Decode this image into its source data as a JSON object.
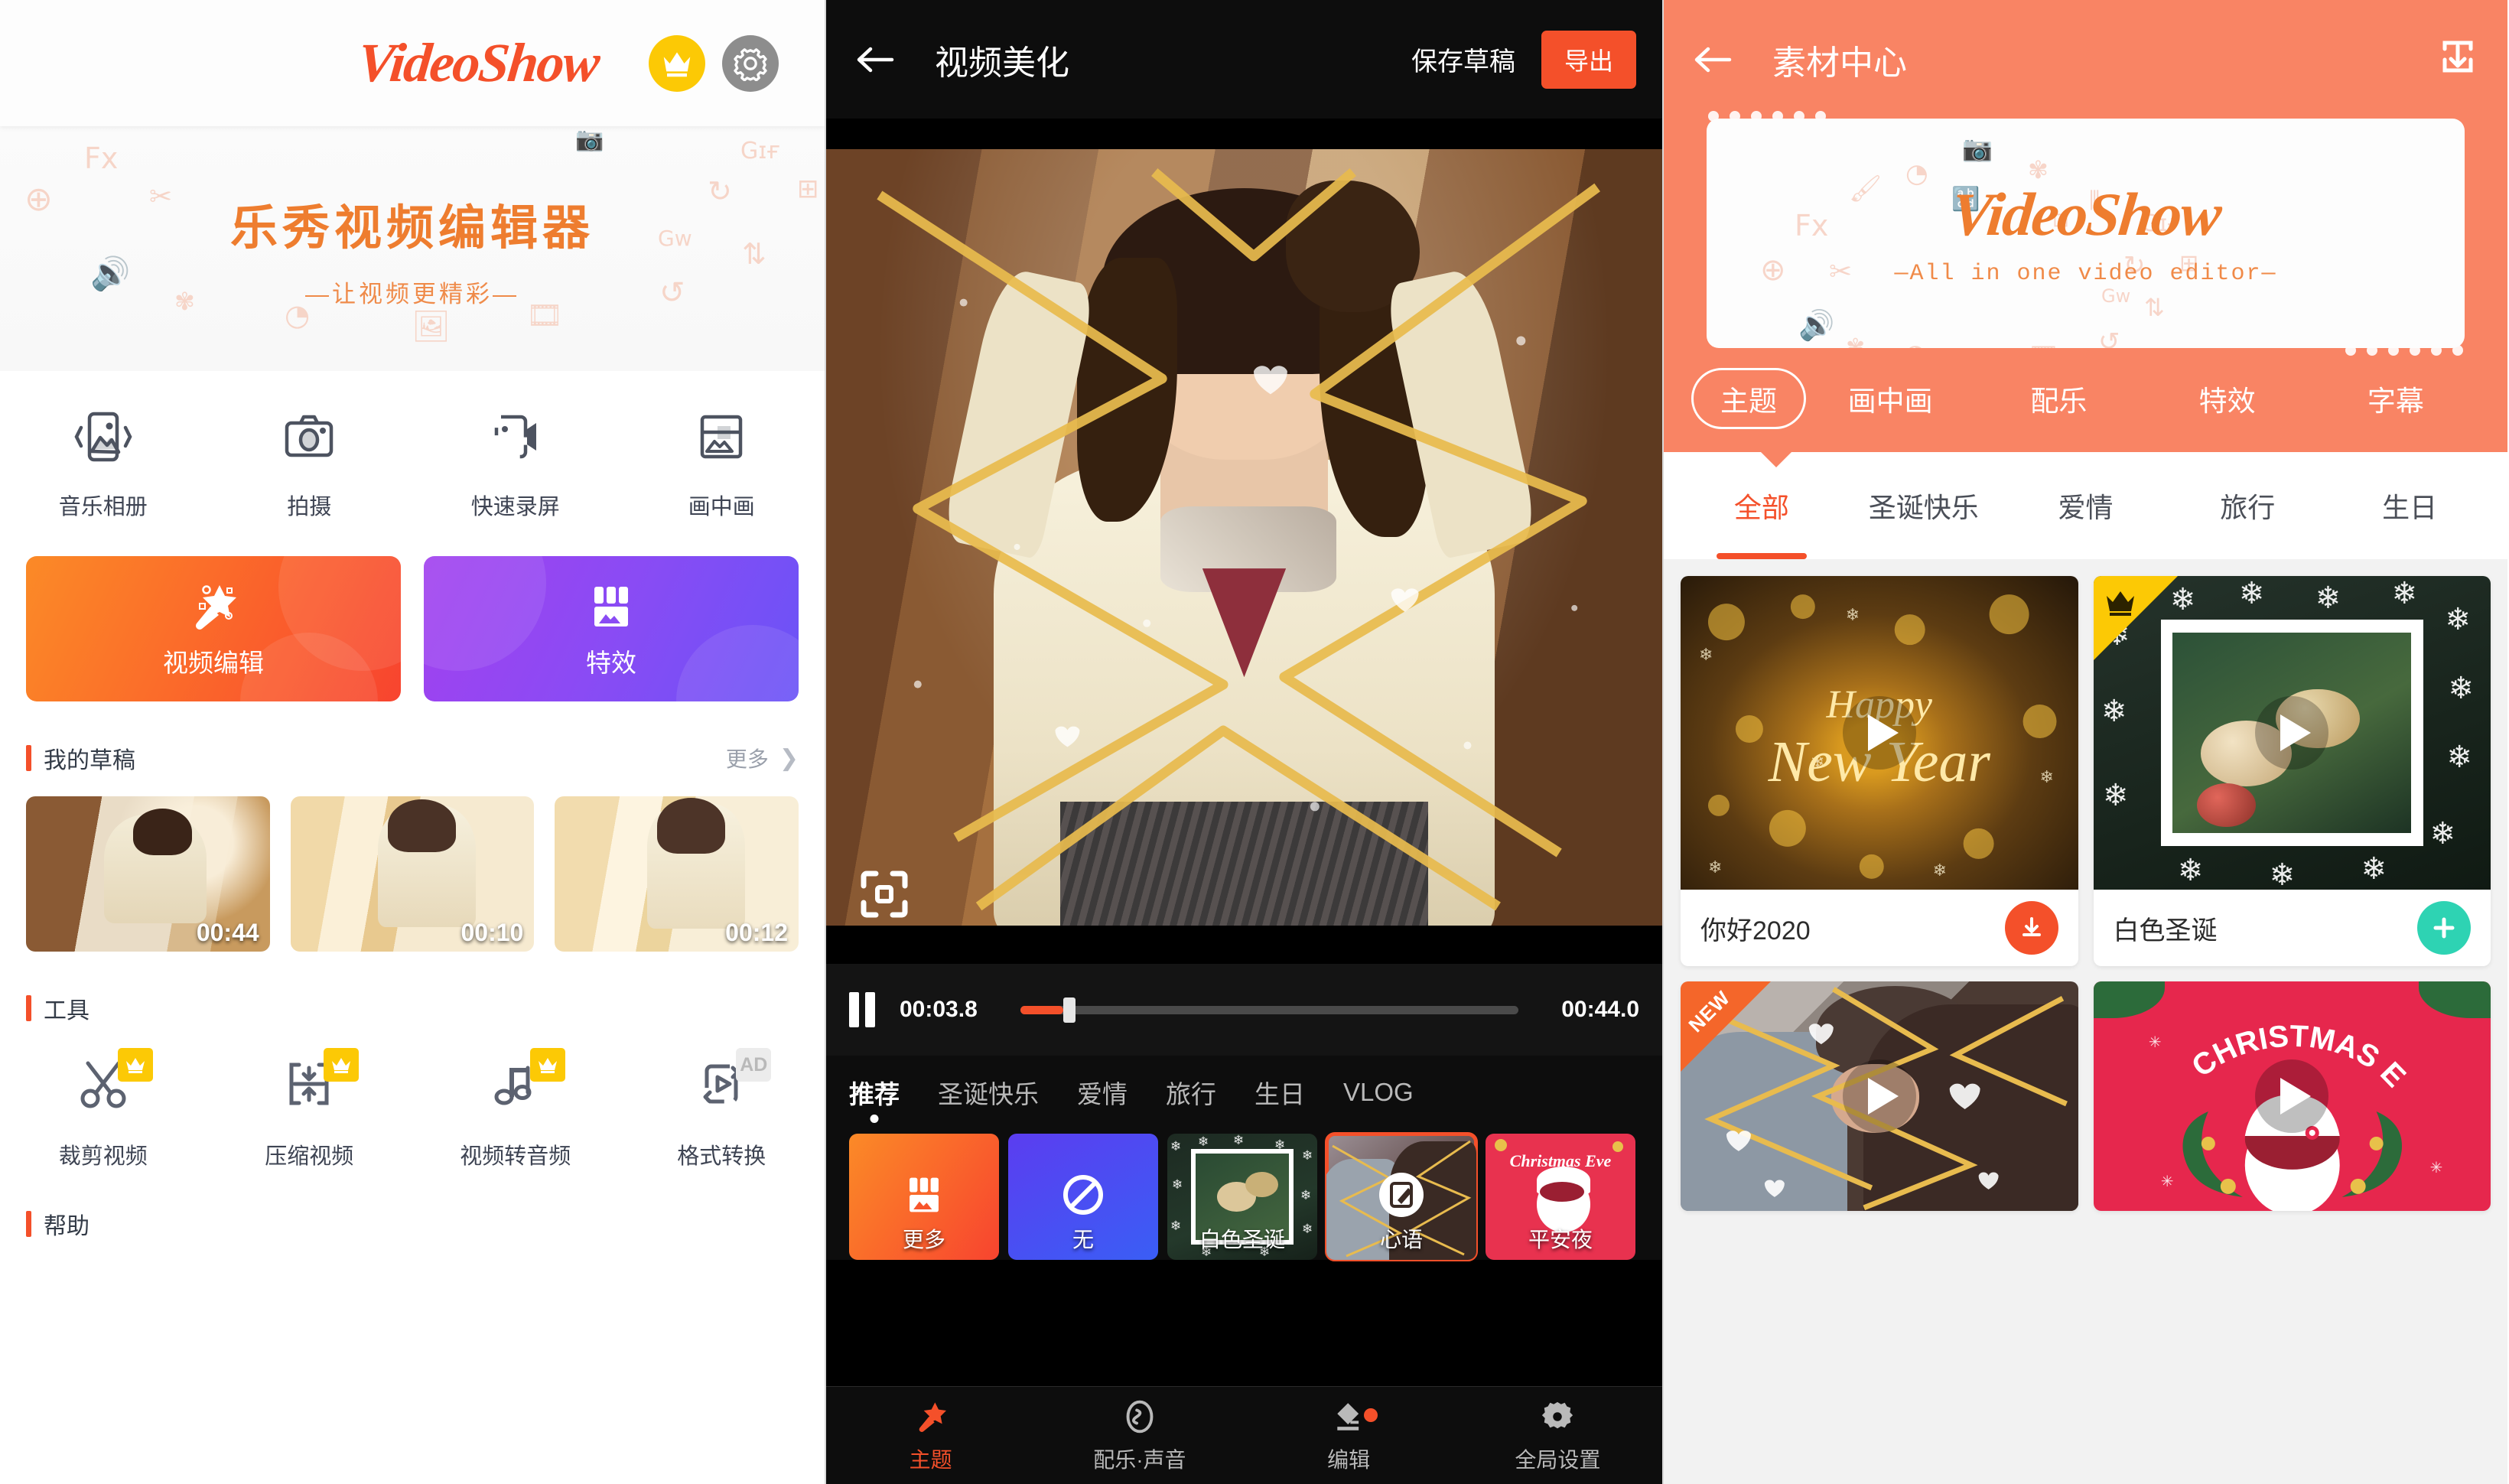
{
  "panel1": {
    "brand": "VideoShow",
    "icons": {
      "crown": "crown-icon",
      "gear": "gear-icon"
    },
    "banner": {
      "title": "乐秀视频编辑器",
      "subtitle": "—让视频更精彩—"
    },
    "shortcuts": [
      {
        "label": "音乐相册",
        "icon": "music-album-icon"
      },
      {
        "label": "拍摄",
        "icon": "camera-icon"
      },
      {
        "label": "快速录屏",
        "icon": "screen-record-icon"
      },
      {
        "label": "画中画",
        "icon": "picture-in-picture-icon"
      }
    ],
    "primary_buttons": [
      {
        "label": "视频编辑",
        "icon": "magic-wand-icon",
        "color": "#f8552c"
      },
      {
        "label": "特效",
        "icon": "effects-store-icon",
        "color": "#8a4bf4"
      }
    ],
    "drafts_section": {
      "title": "我的草稿",
      "more": "更多"
    },
    "drafts": [
      {
        "duration": "00:44"
      },
      {
        "duration": "00:10"
      },
      {
        "duration": "00:12"
      }
    ],
    "tools_section": {
      "title": "工具"
    },
    "tools": [
      {
        "label": "裁剪视频",
        "icon": "scissors-icon",
        "badge": "vip"
      },
      {
        "label": "压缩视频",
        "icon": "compress-icon",
        "badge": "vip"
      },
      {
        "label": "视频转音频",
        "icon": "music-note-icon",
        "badge": "vip"
      },
      {
        "label": "格式转换",
        "icon": "format-convert-icon",
        "badge": "AD"
      }
    ],
    "help_section": {
      "title": "帮助"
    }
  },
  "panel2": {
    "header": {
      "back": "back-arrow-icon",
      "title": "视频美化",
      "save_draft": "保存草稿",
      "export": "导出"
    },
    "player": {
      "crop_icon": "crop-frame-icon",
      "pause_icon": "pause-icon",
      "current_time": "00:03.8",
      "total_time": "00:44.0",
      "progress_percent": 8.6
    },
    "categories": [
      {
        "label": "推荐",
        "active": true
      },
      {
        "label": "圣诞快乐",
        "active": false
      },
      {
        "label": "爱情",
        "active": false
      },
      {
        "label": "旅行",
        "active": false
      },
      {
        "label": "生日",
        "active": false
      },
      {
        "label": "VLOG",
        "active": false
      }
    ],
    "themes": [
      {
        "label": "更多",
        "icon": "store-icon",
        "selected": false
      },
      {
        "label": "无",
        "icon": "none-icon",
        "selected": false
      },
      {
        "label": "白色圣诞",
        "icon": "",
        "selected": false
      },
      {
        "label": "心语",
        "icon": "edit-icon",
        "selected": true
      },
      {
        "label": "平安夜",
        "icon": "",
        "selected": false
      }
    ],
    "nav": [
      {
        "label": "主题",
        "icon": "magic-wand-icon",
        "active": true,
        "dot": false
      },
      {
        "label": "配乐·声音",
        "icon": "audio-icon",
        "active": false,
        "dot": false
      },
      {
        "label": "编辑",
        "icon": "edit-layers-icon",
        "active": false,
        "dot": true
      },
      {
        "label": "全局设置",
        "icon": "gear-icon",
        "active": false,
        "dot": false
      }
    ]
  },
  "panel3": {
    "header": {
      "back": "back-arrow-icon",
      "title": "素材中心",
      "download": "download-box-icon"
    },
    "banner": {
      "logo": "VideoShow",
      "tagline": "—All in one video editor—"
    },
    "tabs": [
      {
        "label": "主题",
        "selected": true
      },
      {
        "label": "画中画",
        "selected": false
      },
      {
        "label": "配乐",
        "selected": false
      },
      {
        "label": "特效",
        "selected": false
      },
      {
        "label": "字幕",
        "selected": false
      }
    ],
    "sub_tabs": [
      {
        "label": "全部",
        "selected": true
      },
      {
        "label": "圣诞快乐",
        "selected": false
      },
      {
        "label": "爱情",
        "selected": false
      },
      {
        "label": "旅行",
        "selected": false
      },
      {
        "label": "生日",
        "selected": false
      }
    ],
    "cards": [
      {
        "name": "你好2020",
        "action": "download-icon",
        "badge": "",
        "media": "happy-new-year"
      },
      {
        "name": "白色圣诞",
        "action": "add-icon",
        "badge": "vip",
        "media": "white-christmas"
      },
      {
        "name": "",
        "action": "",
        "badge": "NEW",
        "media": "love-couple"
      },
      {
        "name": "",
        "action": "",
        "badge": "",
        "media": "christmas-eve"
      }
    ]
  },
  "colors": {
    "brand_orange": "#f4502a",
    "banner_orange": "#ee7d2f",
    "panel3_header": "#f98464",
    "vip_yellow": "#fcc905",
    "purple": "#8a4bf4",
    "teal": "#2ed3b3"
  }
}
